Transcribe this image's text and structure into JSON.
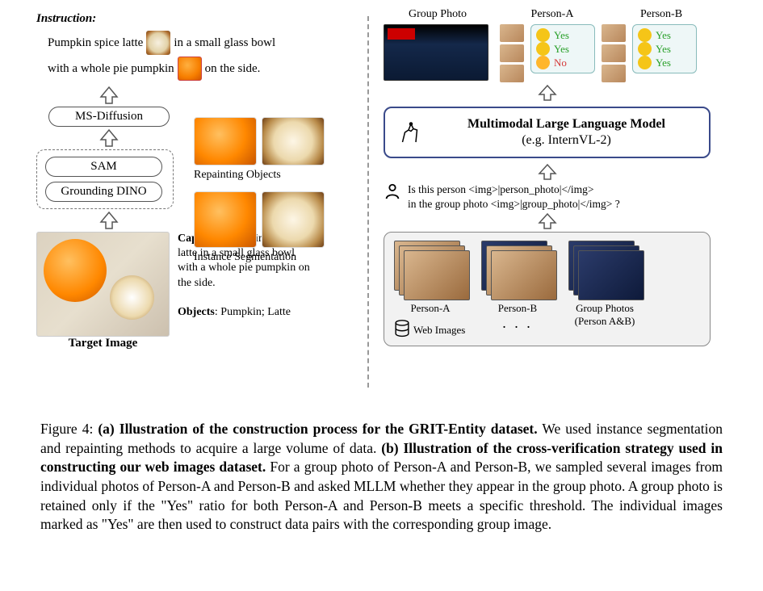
{
  "left": {
    "instruction_header": "Instruction:",
    "instruction_line1_pre": "Pumpkin spice latte",
    "instruction_line1_post": "in a small glass bowl",
    "instruction_line2_pre": "with a whole pie pumpkin",
    "instruction_line2_post": "on the side.",
    "box_msdiff": "MS-Diffusion",
    "box_sam": "SAM",
    "box_gdino": "Grounding DINO",
    "label_repaint": "Repainting Objects",
    "label_instance": "Instance Segmentation",
    "caption_label": "Caption:",
    "caption_text": "Pumpkin spice latte in a small glass bowl with a whole pie pumpkin on the side.",
    "objects_label": "Objects",
    "objects_text": ": Pumpkin; Latte",
    "target_label": "Target Image"
  },
  "right": {
    "label_group": "Group Photo",
    "label_pa": "Person-A",
    "label_pb": "Person-B",
    "yes": "Yes",
    "no": "No",
    "mllm_title": "Multimodal Large Language Model",
    "mllm_sub": "(e.g. InternVL-2)",
    "query_l1": "Is this person <img>|person_photo|</img>",
    "query_l2": "in the group photo <img>|group_photo|</img> ?",
    "web_label": "Web Images",
    "stack_pa": "Person-A",
    "stack_pb": "Person-B",
    "stack_group_l1": "Group Photos",
    "stack_group_l2": "(Person A&B)",
    "ellipsis": ". . ."
  },
  "caption": {
    "fig": "Figure 4: ",
    "a": "(a) Illustration of the construction process for the GRIT-Entity dataset.",
    "a_text": " We used instance segmentation and repainting methods to acquire a large volume of data. ",
    "b": "(b) Illustration of the cross-verification strategy used in constructing our web images dataset.",
    "b_text": " For a group photo of Person-A and Person-B, we sampled several images from individual photos of Person-A and Person-B and asked MLLM whether they appear in the group photo. A group photo is retained only if the \"Yes\" ratio for both Person-A and Person-B meets a specific threshold. The individual images marked as \"Yes\" are then used to construct data pairs with the corresponding group image."
  }
}
